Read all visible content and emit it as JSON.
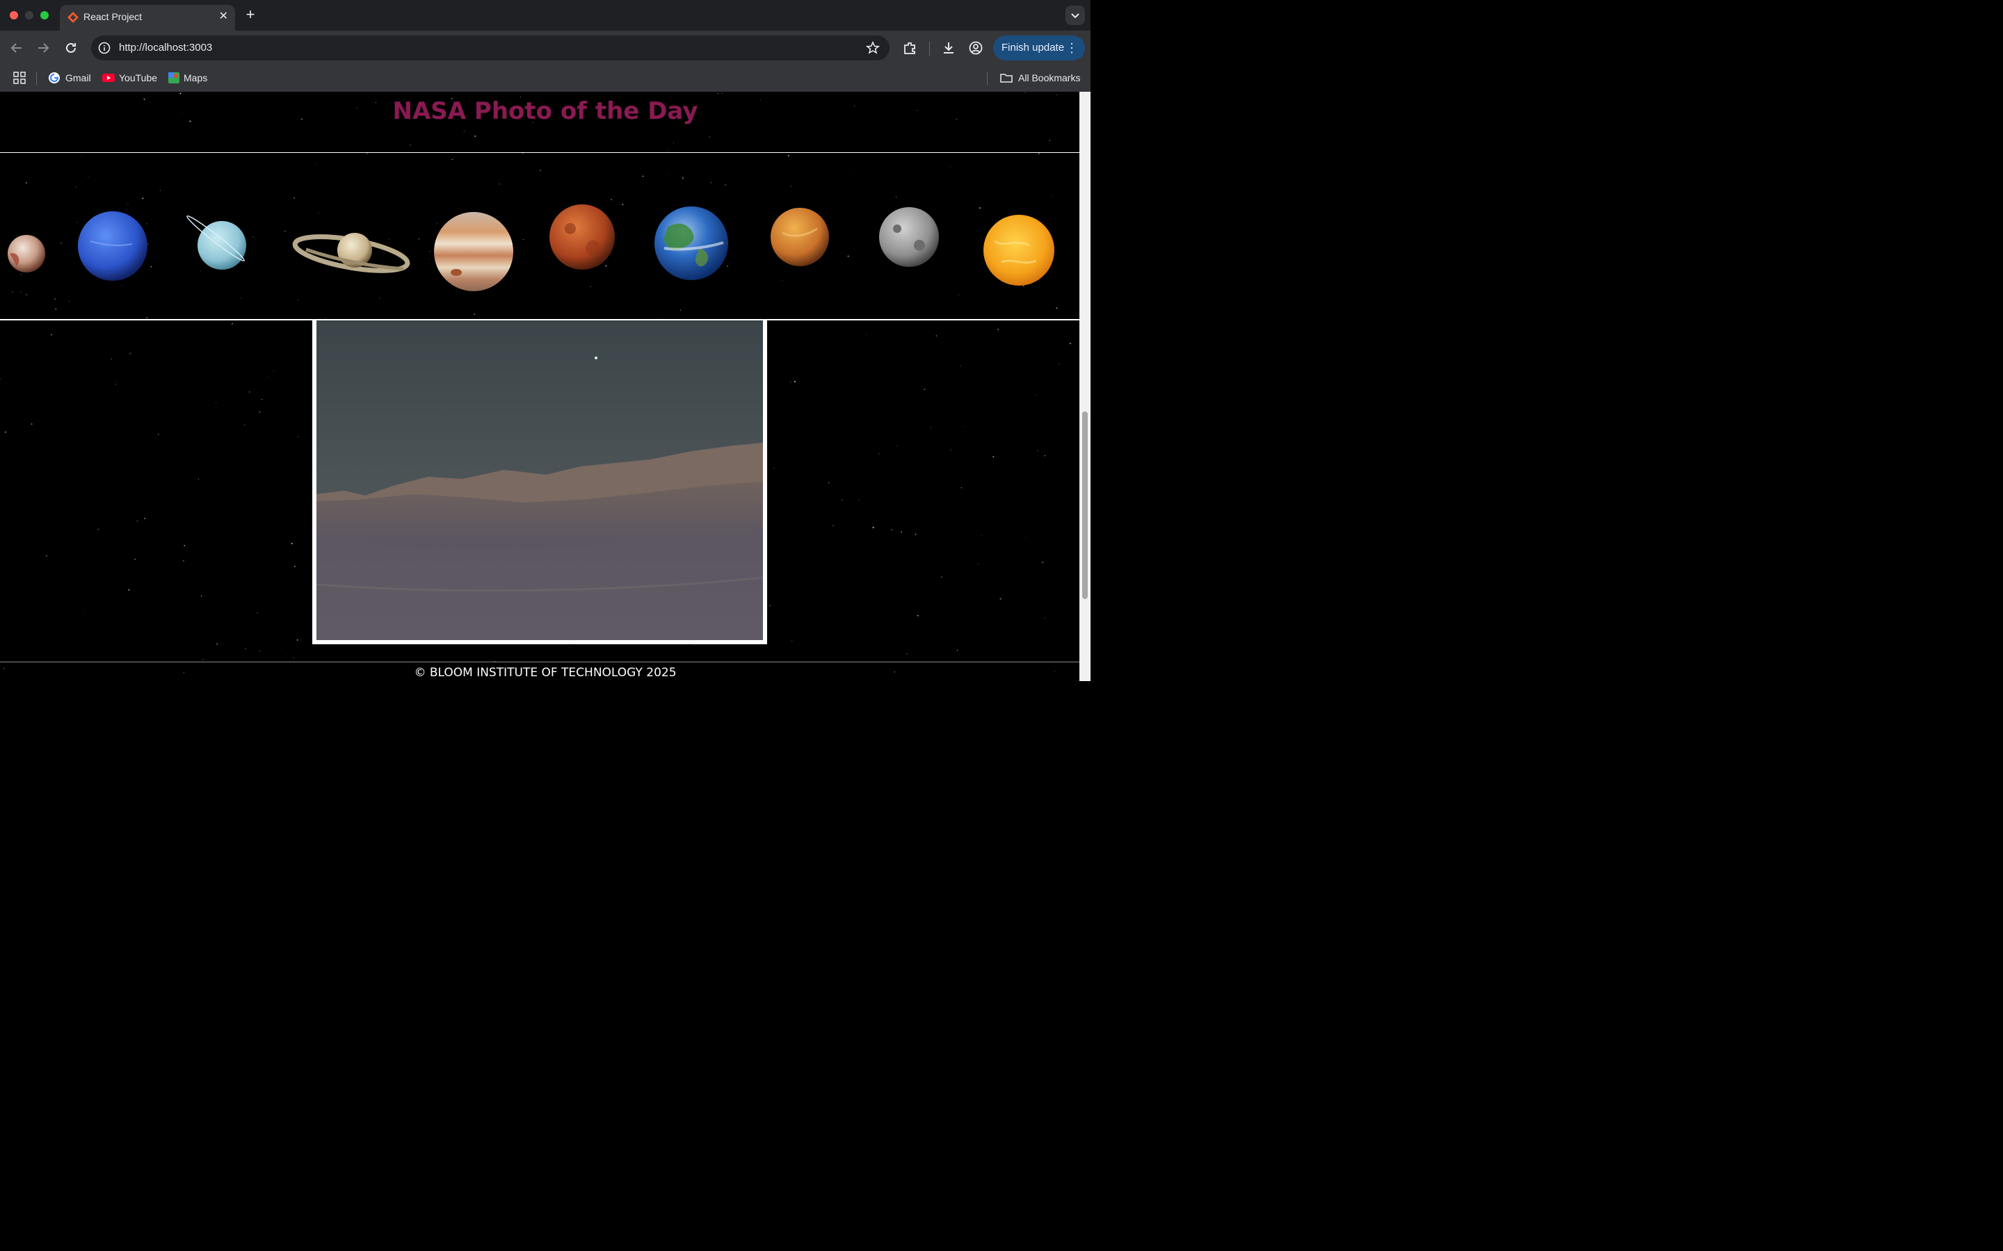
{
  "browser": {
    "tab_title": "React Project",
    "tab_close": "✕",
    "new_tab": "+",
    "url": "http://localhost:3003",
    "update_button": "Finish update",
    "update_menu": "⋮",
    "bookmarks": [
      {
        "label": "Gmail",
        "icon": "gmail-icon"
      },
      {
        "label": "YouTube",
        "icon": "youtube-icon"
      },
      {
        "label": "Maps",
        "icon": "maps-icon"
      }
    ],
    "all_bookmarks": "All Bookmarks"
  },
  "page": {
    "title": "NASA Photo of the Day",
    "footer": "© BLOOM INSTITUTE OF TECHNOLOGY 2025",
    "planets": [
      "pluto",
      "neptune",
      "uranus",
      "saturn",
      "jupiter",
      "mars",
      "earth",
      "venus",
      "mercury",
      "sun"
    ]
  },
  "colors": {
    "title": "#8a1a52",
    "background": "#000000",
    "accent_button": "#1b4d7e"
  }
}
